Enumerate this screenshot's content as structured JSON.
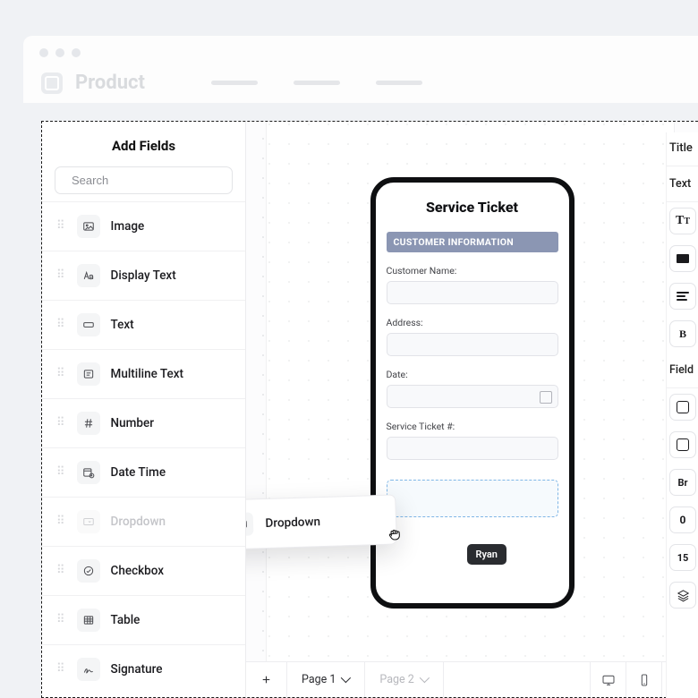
{
  "app": {
    "title": "Product"
  },
  "sidebar": {
    "title": "Add Fields",
    "search_placeholder": "Search",
    "items": [
      {
        "label": "Image"
      },
      {
        "label": "Display Text"
      },
      {
        "label": "Text"
      },
      {
        "label": "Multiline Text"
      },
      {
        "label": "Number"
      },
      {
        "label": "Date Time"
      },
      {
        "label": "Dropdown"
      },
      {
        "label": "Checkbox"
      },
      {
        "label": "Table"
      },
      {
        "label": "Signature"
      }
    ]
  },
  "drag": {
    "label": "Dropdown",
    "user": "Ryan"
  },
  "form": {
    "title": "Service Ticket",
    "section": "CUSTOMER INFORMATION",
    "fields": {
      "name_label": "Customer Name:",
      "address_label": "Address:",
      "date_label": "Date:",
      "ticket_label": "Service Ticket #:"
    }
  },
  "pages": {
    "p1": "Page 1",
    "p2": "Page 2"
  },
  "panel": {
    "title": "Title",
    "text": "Text",
    "bold": "B",
    "field": "Field",
    "br": "Br",
    "v0": "0",
    "v15": "15"
  }
}
